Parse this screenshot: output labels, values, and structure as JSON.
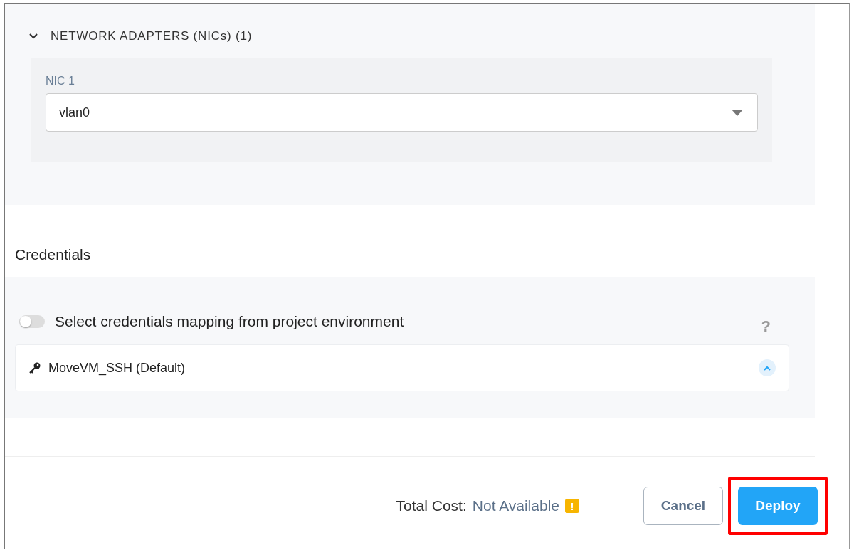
{
  "network_section": {
    "title": "NETWORK ADAPTERS (NICs) (1)",
    "expanded": true,
    "nics": [
      {
        "label": "NIC 1",
        "value": "vlan0"
      }
    ]
  },
  "credentials": {
    "title": "Credentials",
    "toggle": {
      "label": "Select credentials mapping from project environment",
      "on": false
    },
    "help": "?",
    "items": [
      {
        "name": "MoveVM_SSH (Default)",
        "expanded": true
      }
    ]
  },
  "footer": {
    "cost_label": "Total Cost:",
    "cost_value": "Not Available",
    "warning": "!",
    "buttons": [
      {
        "label": "Cancel",
        "kind": "secondary",
        "highlighted": false
      },
      {
        "label": "Deploy",
        "kind": "primary",
        "highlighted": true
      }
    ]
  }
}
